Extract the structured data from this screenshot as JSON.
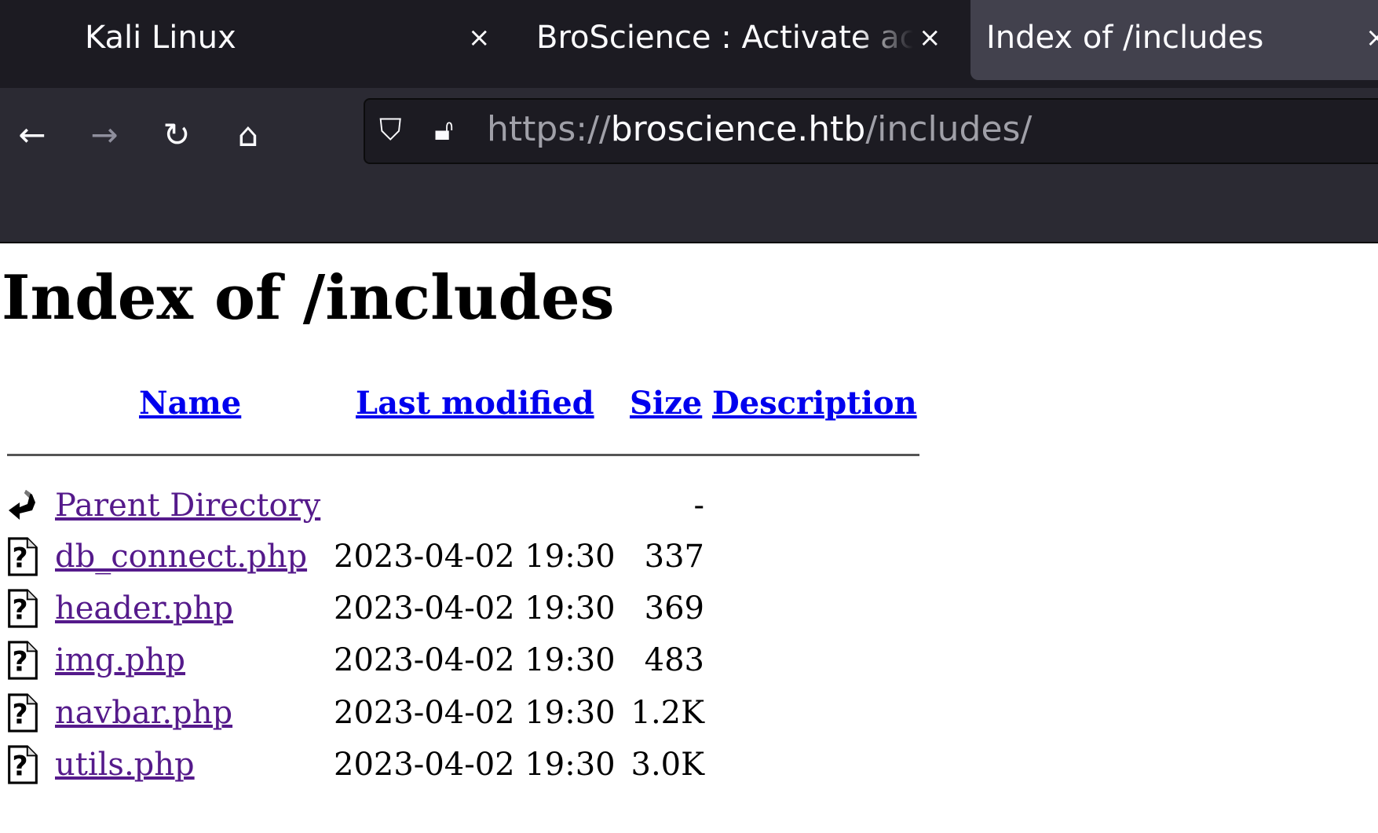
{
  "browser": {
    "tabs": [
      {
        "label": "Kali Linux",
        "active": false
      },
      {
        "label": "BroScience : Activate account",
        "active": false
      },
      {
        "label": "Index of /includes",
        "active": true
      }
    ],
    "url": {
      "scheme": "https://",
      "host": "broscience.htb",
      "path": "/includes/"
    }
  },
  "page": {
    "title": "Index of /includes",
    "columns": {
      "name": "Name",
      "modified": "Last modified",
      "size": "Size",
      "description": "Description"
    },
    "rows": [
      {
        "icon": "back-icon",
        "name": "Parent Directory",
        "modified": "",
        "size": "-"
      },
      {
        "icon": "unknown-file-icon",
        "name": "db_connect.php",
        "modified": "2023-04-02 19:30",
        "size": "337"
      },
      {
        "icon": "unknown-file-icon",
        "name": "header.php",
        "modified": "2023-04-02 19:30",
        "size": "369"
      },
      {
        "icon": "unknown-file-icon",
        "name": "img.php",
        "modified": "2023-04-02 19:30",
        "size": "483"
      },
      {
        "icon": "unknown-file-icon",
        "name": "navbar.php",
        "modified": "2023-04-02 19:30",
        "size": "1.2K"
      },
      {
        "icon": "unknown-file-icon",
        "name": "utils.php",
        "modified": "2023-04-02 19:30",
        "size": "3.0K"
      }
    ]
  }
}
